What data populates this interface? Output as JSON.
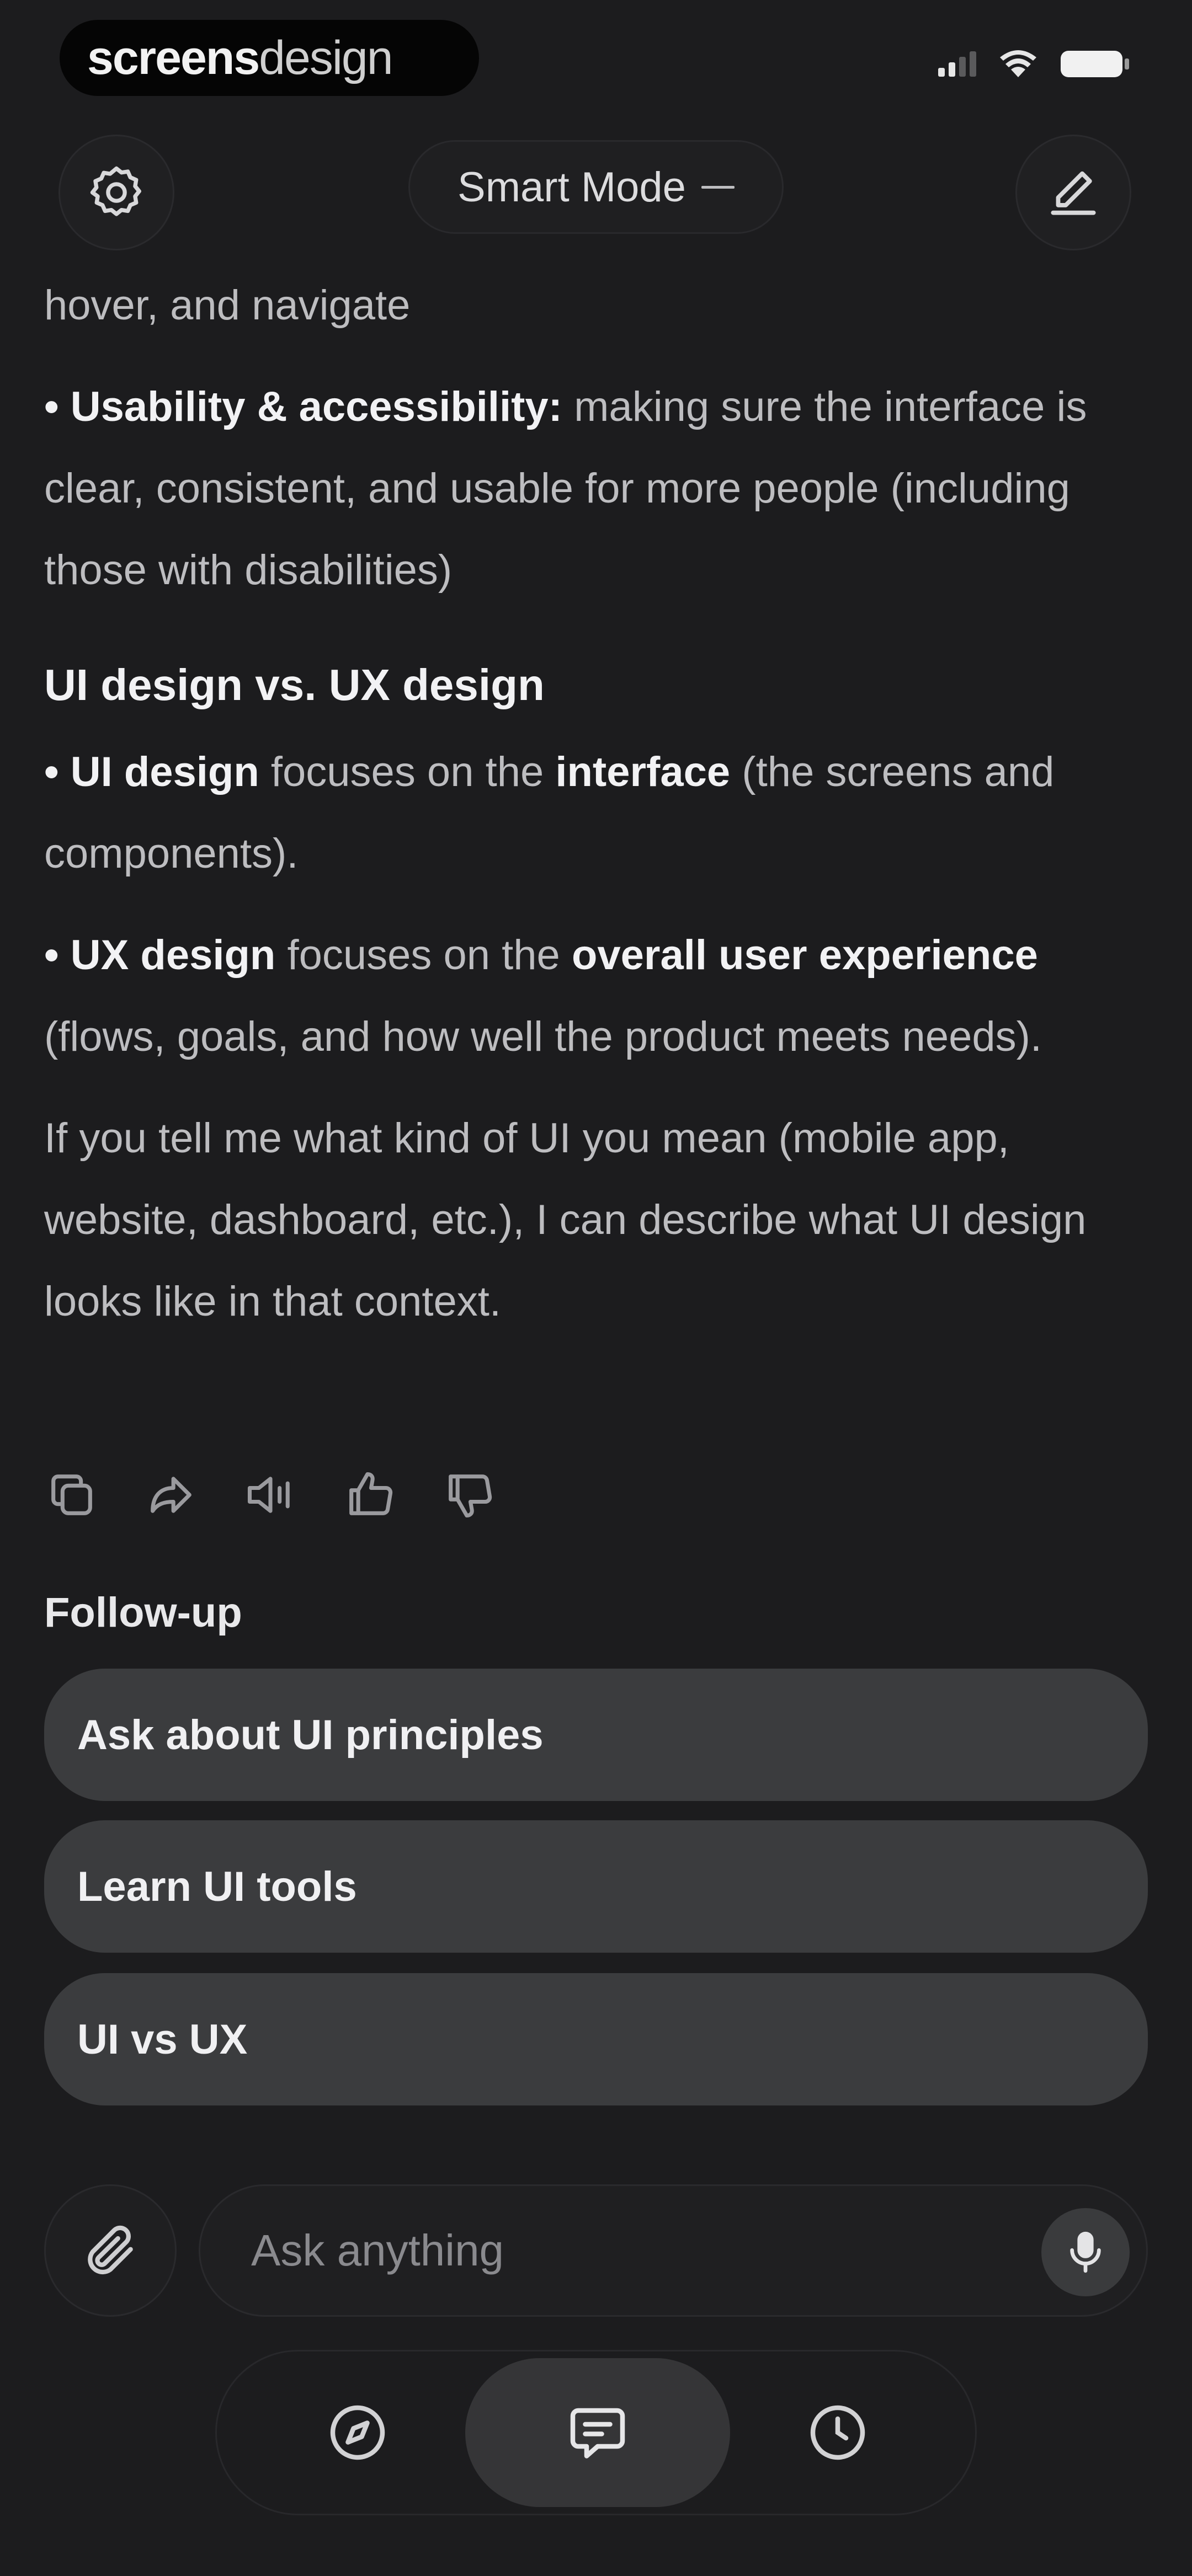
{
  "status_bar": {
    "brand_bold": "screens",
    "brand_light": "design",
    "icons": [
      "cellular-signal-icon",
      "wifi-icon",
      "battery-icon"
    ]
  },
  "header": {
    "mode_label": "Smart Mode",
    "left_icon": "gear-icon",
    "right_icon": "edit-pencil-icon",
    "mode_indicator_icon": "dash-icon"
  },
  "message": {
    "intro_tail": "hover, and navigate",
    "bullet_usability_bold": "Usability & accessibility:",
    "bullet_usability_text": " making sure the interface is clear, consistent, and usable for more people (including those with disabilities)",
    "section_heading": "UI design vs. UX design",
    "bullet_ui_bold1": "UI design",
    "bullet_ui_text1": " focuses on the ",
    "bullet_ui_bold2": "interface",
    "bullet_ui_text2": " (the screens and components).",
    "bullet_ux_bold1": "UX design",
    "bullet_ux_text1": " focuses on the ",
    "bullet_ux_bold2": "overall user experience",
    "bullet_ux_text2": " (flows, goals, and how well the product meets needs).",
    "closing": "If you tell me what kind of UI you mean (mobile app, website, dashboard, etc.), I can describe what UI design looks like in that context.",
    "bullet_symbol": "•"
  },
  "message_actions": [
    "copy-icon",
    "share-icon",
    "speaker-icon",
    "thumbs-up-icon",
    "thumbs-down-icon"
  ],
  "follow_up": {
    "label": "Follow-up",
    "suggestions": [
      "Ask about UI principles",
      "Learn UI tools",
      "UI vs UX"
    ]
  },
  "composer": {
    "placeholder": "Ask anything",
    "attach_icon": "paperclip-icon",
    "voice_icon": "microphone-icon"
  },
  "tab_bar": {
    "tabs": [
      "compass-icon",
      "chat-icon",
      "clock-icon"
    ],
    "active_tab": "chat-icon"
  }
}
